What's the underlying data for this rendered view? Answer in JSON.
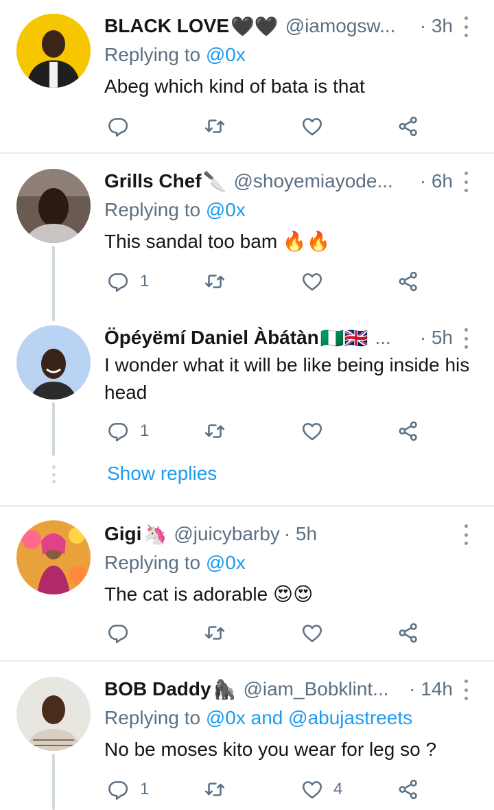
{
  "tweets": [
    {
      "name": "BLACK LOVE",
      "name_emoji": "🖤🖤",
      "handle": "@iamogsw...",
      "time": "· 3h",
      "replying_label": "Replying to",
      "replying_to": "@0x",
      "text": "Abeg which kind of bata is that",
      "replies": "",
      "likes": ""
    },
    {
      "name": "Grills Chef",
      "name_emoji": "🔪",
      "handle": "@shoyemiayode...",
      "time": "· 6h",
      "replying_label": "Replying to",
      "replying_to": "@0x",
      "text": "This sandal too bam 🔥🔥",
      "replies": "1",
      "likes": ""
    },
    {
      "name": "Öpéyëmí Daniel Àbátàn",
      "name_emoji": "🇳🇬🇬🇧",
      "handle": "...",
      "time": "· 5h",
      "text": "I wonder what it will be like being inside his head",
      "replies": "1",
      "likes": "",
      "show_replies": "Show replies"
    },
    {
      "name": "Gigi",
      "name_emoji": "🦄",
      "handle": "@juicybarby",
      "time": "· 5h",
      "replying_label": "Replying to",
      "replying_to": "@0x",
      "text": "The cat is adorable 😍😍",
      "replies": "",
      "likes": ""
    },
    {
      "name": "BOB Daddy",
      "name_emoji": "🦍",
      "handle": "@iam_Bobklint...",
      "time": "· 14h",
      "replying_label": "Replying to",
      "replying_to": "@0x",
      "replying_and": "and",
      "replying_to_2": "@abujastreets",
      "text": "No be moses kito you wear for leg so ?",
      "replies": "1",
      "likes": "4"
    }
  ],
  "icons": {
    "reply": "reply-icon",
    "retweet": "retweet-icon",
    "like": "heart-icon",
    "share": "share-icon",
    "more": "more-vertical-icon"
  },
  "colors": {
    "link": "#1d9bf0",
    "muted": "#5b7083",
    "divider": "#e6ecf0"
  }
}
